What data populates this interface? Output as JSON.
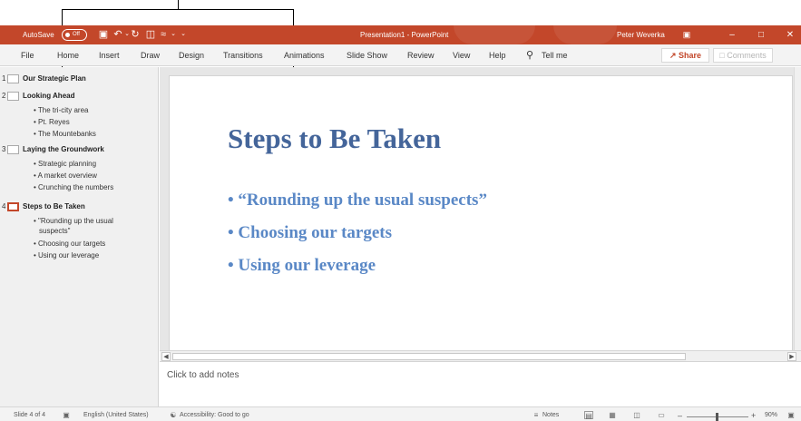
{
  "titlebar": {
    "autosave_label": "AutoSave",
    "autosave_state": "Off",
    "doc_title": "Presentation1 - PowerPoint",
    "user_name": "Peter Weverka",
    "accent_color": "#c3472a"
  },
  "ribbon": {
    "tabs": [
      "File",
      "Home",
      "Insert",
      "Draw",
      "Design",
      "Transitions",
      "Animations",
      "Slide Show",
      "Review",
      "View",
      "Help"
    ],
    "tell_me": "Tell me",
    "share_label": "Share",
    "comments_label": "Comments"
  },
  "outline": {
    "slides": [
      {
        "num": "1",
        "title": "Our Strategic Plan",
        "bullets": []
      },
      {
        "num": "2",
        "title": "Looking Ahead",
        "bullets": [
          "The tri-city area",
          "Pt. Reyes",
          "The Mountebanks"
        ]
      },
      {
        "num": "3",
        "title": "Laying the Groundwork",
        "bullets": [
          "Strategic planning",
          "A market overview",
          "Crunching the numbers"
        ]
      },
      {
        "num": "4",
        "title": "Steps to Be Taken",
        "bullets": [
          "\"Rounding up the usual",
          "suspects\"",
          "Choosing our targets",
          "Using our leverage"
        ]
      }
    ]
  },
  "slide": {
    "title": "Steps to Be Taken",
    "bullets": [
      "“Rounding up the usual suspects”",
      "Choosing our targets",
      "Using our leverage"
    ]
  },
  "notes": {
    "placeholder": "Click to add notes"
  },
  "statusbar": {
    "slide_info": "Slide 4 of 4",
    "language": "English (United States)",
    "accessibility": "Accessibility: Good to go",
    "notes_label": "Notes",
    "zoom": "90%"
  }
}
